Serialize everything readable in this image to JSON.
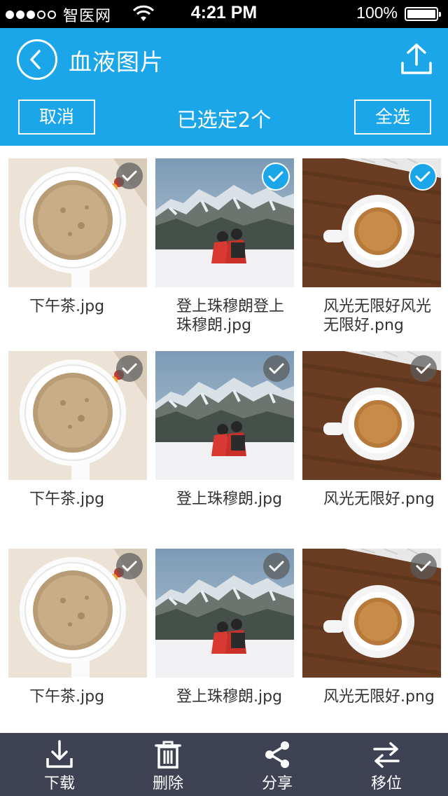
{
  "status_bar": {
    "carrier": "智医网",
    "time": "4:21 PM",
    "battery": "100%"
  },
  "header": {
    "title": "血液图片",
    "cancel_label": "取消",
    "selected_text": "已选定2个",
    "select_all_label": "全选"
  },
  "files": [
    {
      "name": "下午茶.jpg",
      "image": "coffee-top",
      "selected": false
    },
    {
      "name": "登上珠穆朗登上珠穆朗.jpg",
      "image": "mountain",
      "selected": true
    },
    {
      "name": "风光无限好风光无限好.png",
      "image": "coffee-desk",
      "selected": true
    },
    {
      "name": "下午茶.jpg",
      "image": "coffee-top",
      "selected": false
    },
    {
      "name": "登上珠穆朗.jpg",
      "image": "mountain",
      "selected": false
    },
    {
      "name": "风光无限好.png",
      "image": "coffee-desk",
      "selected": false
    },
    {
      "name": "下午茶.jpg",
      "image": "coffee-top",
      "selected": false
    },
    {
      "name": "登上珠穆朗.jpg",
      "image": "mountain",
      "selected": false
    },
    {
      "name": "风光无限好.png",
      "image": "coffee-desk",
      "selected": false
    }
  ],
  "toolbar": {
    "download_label": "下载",
    "delete_label": "删除",
    "share_label": "分享",
    "move_label": "移位"
  },
  "icons": {
    "back": "back-icon",
    "upload": "upload-icon",
    "download": "download-icon",
    "delete": "trash-icon",
    "share": "share-icon",
    "move": "swap-arrows-icon",
    "check": "check-icon"
  },
  "colors": {
    "accent": "#1aa6e9",
    "toolbar_bg": "#3f4252",
    "status_bar_bg": "#000000"
  }
}
